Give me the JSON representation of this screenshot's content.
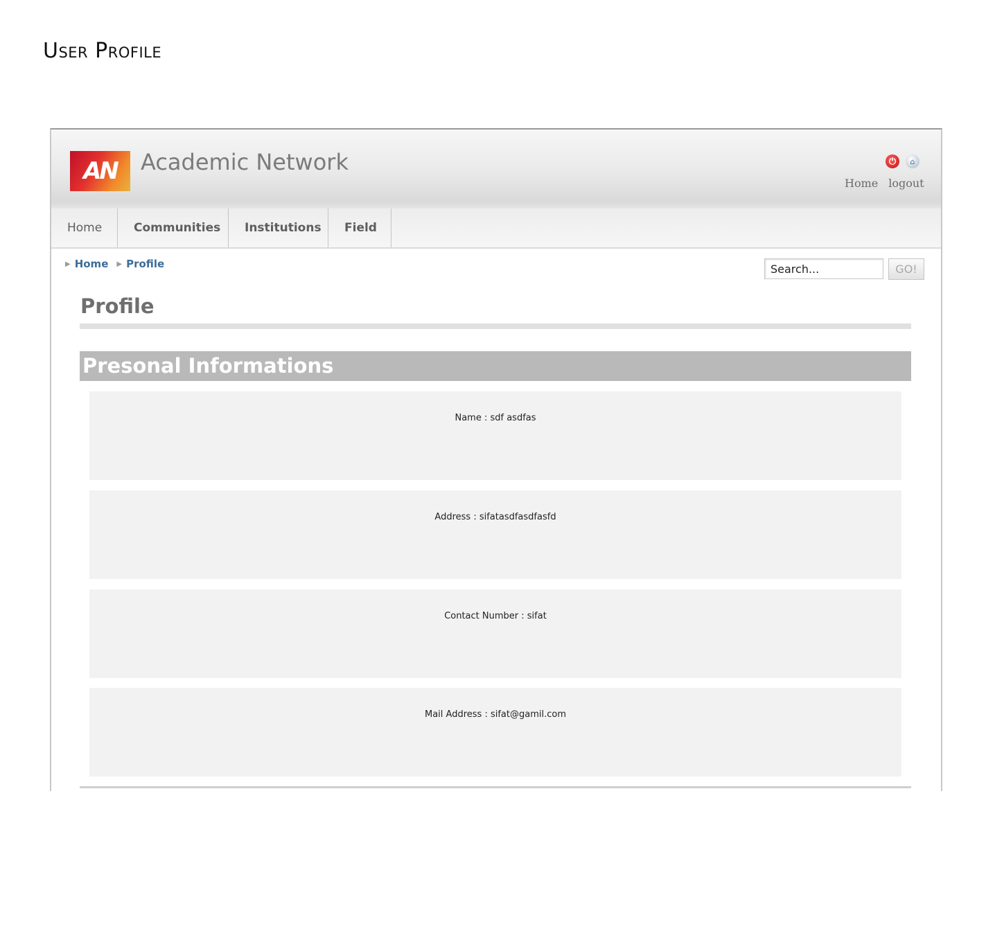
{
  "document": {
    "heading": "User Profile"
  },
  "site": {
    "logo_text": "AN",
    "title": "Academic Network",
    "top_links": [
      "Home",
      "logout"
    ],
    "icons": [
      "power-icon",
      "home-globe-icon"
    ]
  },
  "nav": {
    "items": [
      "Home",
      "Communities",
      "Institutions",
      "Field"
    ]
  },
  "breadcrumb": {
    "items": [
      "Home",
      "Profile"
    ]
  },
  "search": {
    "placeholder": "Search...",
    "button_label": "GO!"
  },
  "page": {
    "title": "Profile",
    "section_title": "Presonal Informations"
  },
  "profile": {
    "fields": [
      "Name : sdf asdfas",
      "Address : sifatasdfasdfasfd",
      "Contact Number : sifat",
      "Mail Address : sifat@gamil.com"
    ]
  },
  "colors": {
    "section_bar": "#b9b9b9",
    "card_bg": "#f2f2f2",
    "breadcrumb_link": "#3d6d98",
    "logo_red": "#c0102a"
  }
}
